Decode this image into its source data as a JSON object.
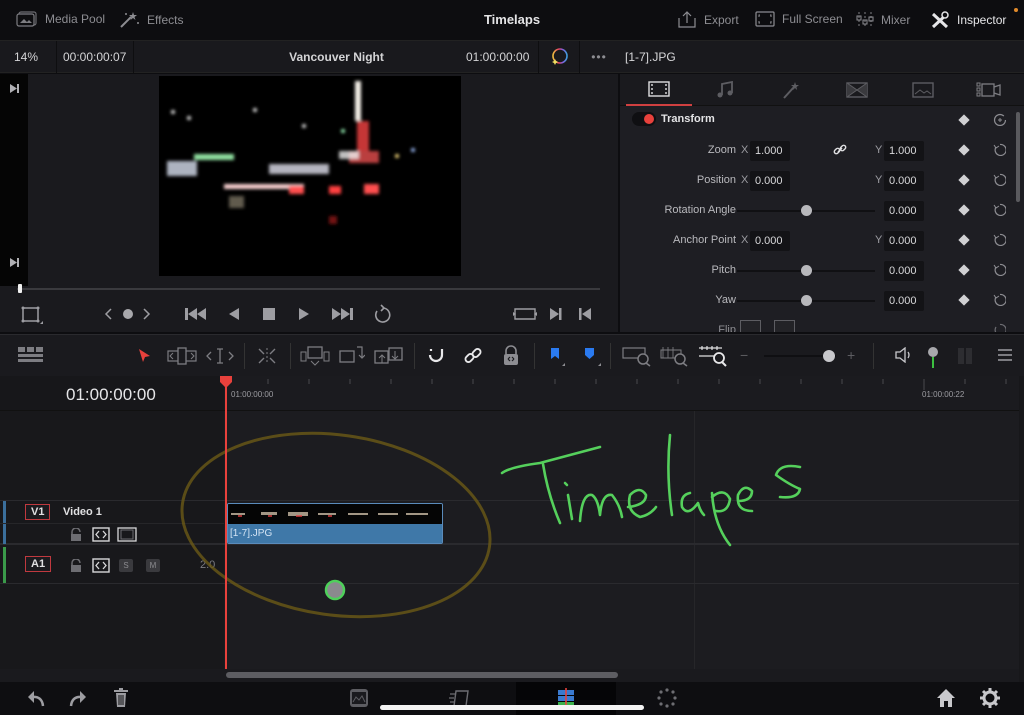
{
  "topbar": {
    "media_pool_label": "Media Pool",
    "effects_label": "Effects",
    "project_title": "Timelaps",
    "export_label": "Export",
    "fullscreen_label": "Full Screen",
    "mixer_label": "Mixer",
    "inspector_label": "Inspector"
  },
  "viewer": {
    "zoom_level": "14%",
    "source_timecode": "00:00:00:07",
    "timeline_name": "Vancouver Night",
    "record_timecode": "01:00:00:00",
    "more_label": "•••",
    "playhead_progress": 0.0
  },
  "inspector": {
    "clip_name": "[1-7].JPG",
    "tabs": [
      "video-tab",
      "audio-tab",
      "effects-tab",
      "transition-tab",
      "image-tab",
      "file-tab"
    ],
    "active_tab": "video-tab",
    "section_title": "Transform",
    "section_enabled": true,
    "rows": [
      {
        "label": "Zoom",
        "x": "1.000",
        "y": "1.000",
        "linked": true
      },
      {
        "label": "Position",
        "x": "0.000",
        "y": "0.000"
      },
      {
        "label": "Rotation Angle",
        "value": "0.000",
        "slider": 0.5
      },
      {
        "label": "Anchor Point",
        "x": "0.000",
        "y": "0.000"
      },
      {
        "label": "Pitch",
        "value": "0.000",
        "slider": 0.5
      },
      {
        "label": "Yaw",
        "value": "0.000",
        "slider": 0.5
      },
      {
        "label": "Flip"
      }
    ],
    "axis_x": "X",
    "axis_y": "Y"
  },
  "timeline": {
    "current_timecode": "01:00:00:00",
    "ruler_start": "01:00:00:00",
    "ruler_end": "01:00:00:22",
    "zoom_slider": 0.75,
    "tracks": {
      "video": {
        "id": "V1",
        "name": "Video 1"
      },
      "audio": {
        "id": "A1",
        "solo": "S",
        "mute": "M",
        "level": "2.0"
      }
    },
    "clip": {
      "name": "[1-7].JPG"
    },
    "annotation": "Timelapes"
  },
  "colors": {
    "accent_red": "#e8413c",
    "clip_blue": "#3f78a8",
    "annotation_green": "#55d05c",
    "annotation_yellow": "#6b5a17"
  }
}
